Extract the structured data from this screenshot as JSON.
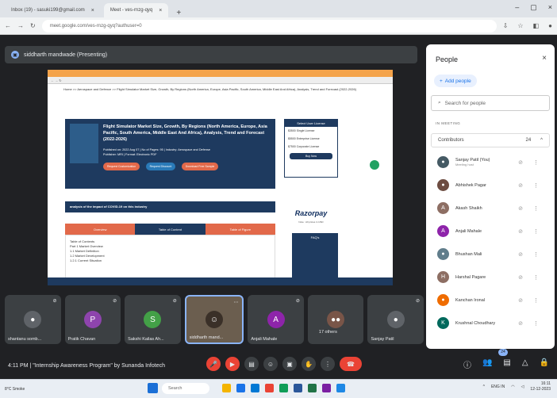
{
  "browser": {
    "tabs": [
      {
        "label": "Inbox (19) - sasuki199@gmail.com"
      },
      {
        "label": "Meet - ves-rnzg-qyq"
      }
    ],
    "url": "meet.google.com/ves-rnzg-qyq?authuser=0"
  },
  "presenting": {
    "label": "siddharth mandwade (Presenting)",
    "dot_icon": "screen-share-icon"
  },
  "shared": {
    "crumb": "Home >> Aerospace and Defence >> Flight Simulator Market Size, Growth, By Regions (North America, Europe, Asia Pacific, South America, Middle East And Africa), Analysis, Trend and Forecast (2022-2026)",
    "report_title": "Flight Simulator Market Size, Growth, By Regions (North America, Europe, Asia Pacific, South America, Middle East And Africa), Analysis, Trend and Forecast (2022-2026)",
    "report_meta1": "Published on: 2022 Aug 07 | No of Pages: 95 | Industry: Aerospace and Defense",
    "report_meta2": "Publisher: MRI | Format: Electronic PDF",
    "btn1": "Request Customization",
    "btn2": "Request Discount",
    "btn3": "Download Free Sample",
    "license_head": "Select User License",
    "licenses": [
      "$3500 Single License",
      "$5500 Enterprise License",
      "$7500 Corporate License"
    ],
    "buy": "Buy Now",
    "razorpay": "Razorpay",
    "razorpay_sub": "Note : All prices in USD",
    "covid": "analysis of the impact of COVID-19 on this industry",
    "toc_tabs": [
      "Overview",
      "Table of Content",
      "Table of Figure"
    ],
    "toc_lines": [
      "Table of Contents",
      "Part 1 Market Overview",
      "1.1 Market Definition",
      "1.2 Market Development",
      "1.2.1 Current Situation"
    ],
    "faq": "FAQ's"
  },
  "tiles": [
    {
      "name": "shantanu somb...",
      "initial": "",
      "color": "#5f6368"
    },
    {
      "name": "Pratik Chavan",
      "initial": "P",
      "color": "#8e44ad"
    },
    {
      "name": "Sakshi Kailas Ah...",
      "initial": "S",
      "color": "#43a047"
    },
    {
      "name": "siddharth mand...",
      "initial": "",
      "color": "#6b5e4f"
    },
    {
      "name": "Anjali Mahale",
      "initial": "A",
      "color": "#8e24aa"
    },
    {
      "name": "17 others",
      "initial": "",
      "color": "#795548"
    },
    {
      "name": "Sanjay Patil",
      "initial": "",
      "color": "#5f6368"
    }
  ],
  "meeting": {
    "time_title": "4:11 PM | \"Internship Awareness Program\" by Sunanda Infotech",
    "people_badge": "24"
  },
  "people_panel": {
    "title": "People",
    "add_people": "Add people",
    "search_placeholder": "Search for people",
    "in_meeting": "IN MEETING",
    "contributors": "Contributors",
    "count": "24",
    "people": [
      {
        "name": "Sanjay Patil (You)",
        "sub": "Meeting host",
        "color": "#455a64",
        "initial": ""
      },
      {
        "name": "Abhishek Pagar",
        "sub": "",
        "color": "#6d4c41",
        "initial": ""
      },
      {
        "name": "Akash Shaikh",
        "sub": "",
        "color": "#8d6e63",
        "initial": "A"
      },
      {
        "name": "Anjali Mahale",
        "sub": "",
        "color": "#8e24aa",
        "initial": "A"
      },
      {
        "name": "Bhushan Mali",
        "sub": "",
        "color": "#607d8b",
        "initial": ""
      },
      {
        "name": "Harshal Pagare",
        "sub": "",
        "color": "#8d6e63",
        "initial": "H"
      },
      {
        "name": "Kanchan Ironal",
        "sub": "",
        "color": "#ef6c00",
        "initial": ""
      },
      {
        "name": "Krushnal Choudhary",
        "sub": "",
        "color": "#00695c",
        "initial": "K"
      }
    ]
  },
  "windows": {
    "weather": "8°C Smoke",
    "search": "Search",
    "clock_time": "16:11",
    "clock_date": "12-12-2023",
    "lang": "ENG IN"
  }
}
